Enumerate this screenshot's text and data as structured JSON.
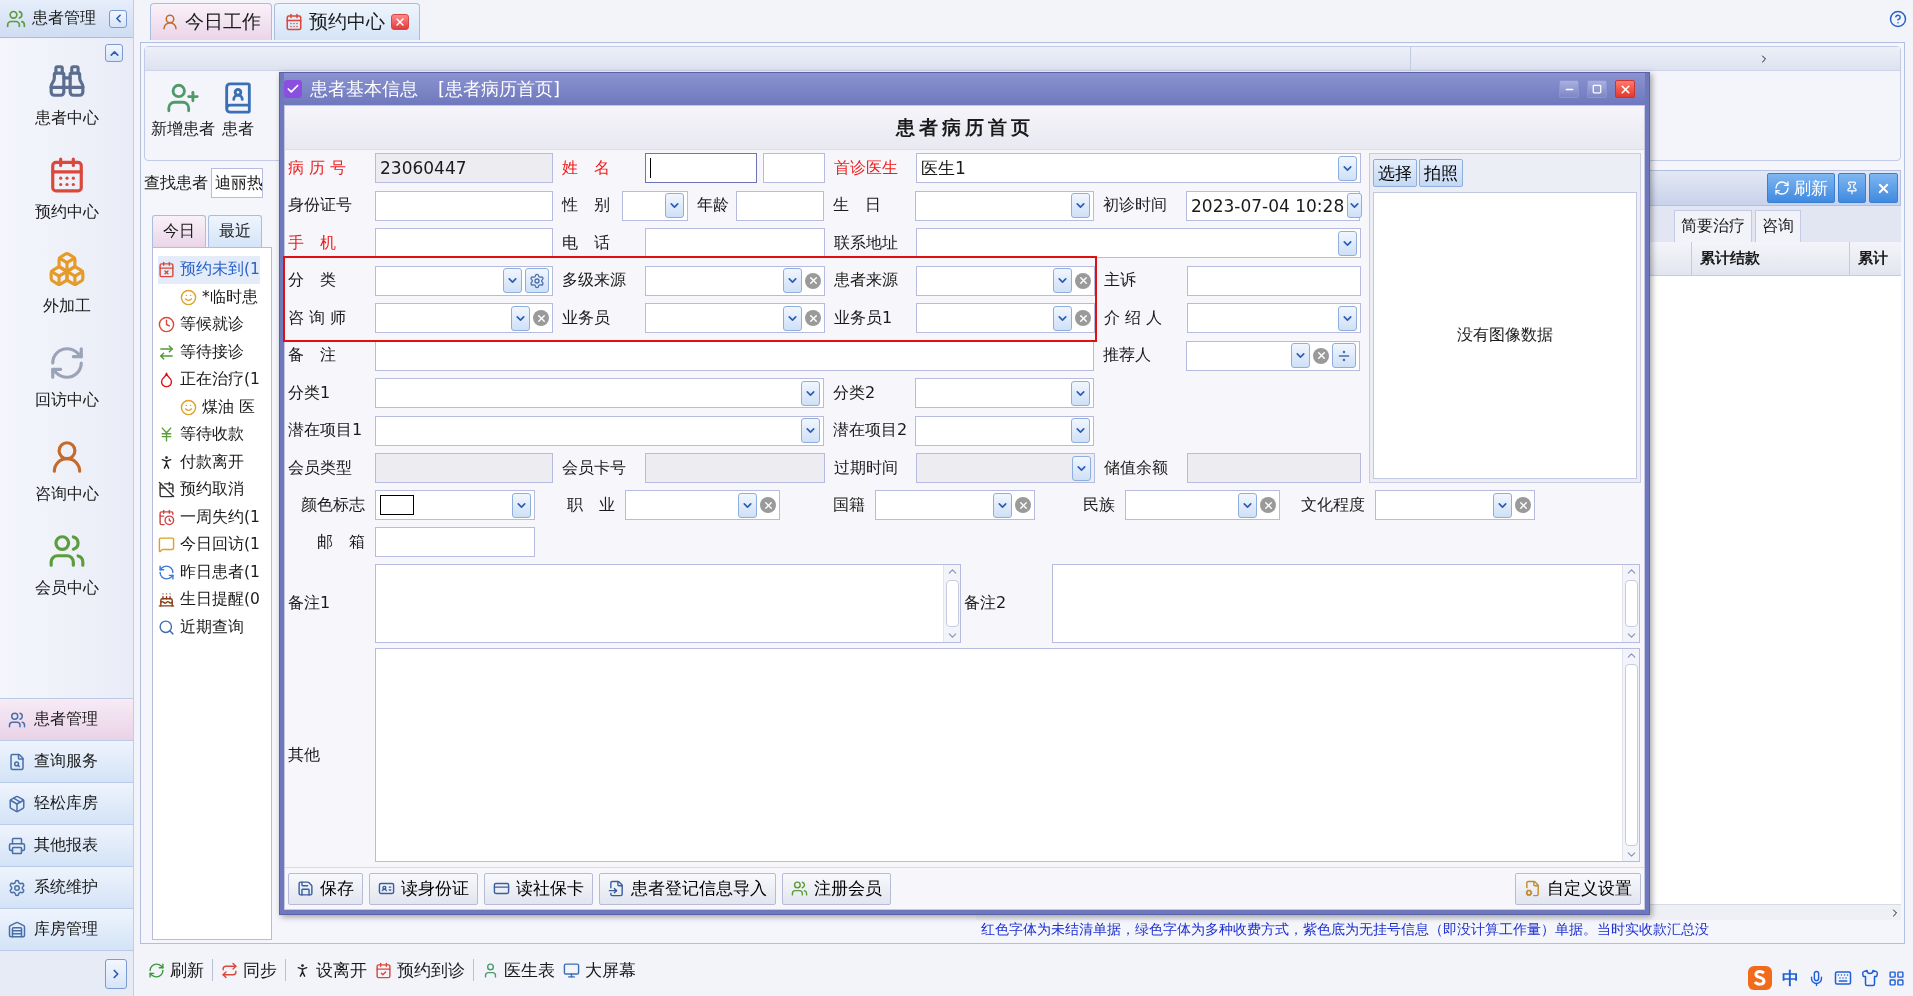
{
  "sidebar": {
    "title": "患者管理",
    "nav": [
      {
        "label": "患者中心"
      },
      {
        "label": "预约中心"
      },
      {
        "label": "外加工"
      },
      {
        "label": "回访中心"
      },
      {
        "label": "咨询中心"
      },
      {
        "label": "会员中心"
      }
    ],
    "sections": [
      {
        "label": "患者管理",
        "selected": true
      },
      {
        "label": "查询服务",
        "selected": false
      },
      {
        "label": "轻松库房",
        "selected": false
      },
      {
        "label": "其他报表",
        "selected": false
      },
      {
        "label": "系统维护",
        "selected": false
      },
      {
        "label": "库房管理",
        "selected": false
      }
    ]
  },
  "tabs": [
    {
      "label": "今日工作",
      "selected": true,
      "closable": false
    },
    {
      "label": "预约中心",
      "selected": false,
      "closable": true
    }
  ],
  "ribbon": {
    "buttons": [
      {
        "label": "新增患者"
      },
      {
        "label": "患者"
      }
    ]
  },
  "search": {
    "label": "查找患者",
    "value": "迪丽热"
  },
  "list_tabs": [
    {
      "label": "今日",
      "selected": true
    },
    {
      "label": "最近",
      "selected": false
    }
  ],
  "tree": [
    {
      "label": "预约未到(1",
      "selected": true,
      "children": [
        {
          "label": "*临时患",
          "selected": false
        }
      ]
    },
    {
      "label": "等候就诊",
      "selected": false
    },
    {
      "label": "等待接诊",
      "selected": false
    },
    {
      "label": "正在治疗(1",
      "selected": false,
      "children": [
        {
          "label": "煤油 医",
          "selected": false
        }
      ]
    },
    {
      "label": "等待收款",
      "selected": false
    },
    {
      "label": "付款离开",
      "selected": false
    },
    {
      "label": "预约取消",
      "selected": false
    },
    {
      "label": "一周失约(1",
      "selected": false
    },
    {
      "label": "今日回访(1",
      "selected": false
    },
    {
      "label": "昨日患者(1",
      "selected": false
    },
    {
      "label": "生日提醒(0",
      "selected": false
    },
    {
      "label": "近期查询",
      "selected": false
    }
  ],
  "detail_panel": {
    "buttons": [
      {
        "label": "刷新"
      }
    ],
    "tabs": [
      {
        "label": "简要治疗"
      },
      {
        "label": "咨询"
      }
    ],
    "columns": [
      "累计结款",
      "累计"
    ],
    "note": "红色字体为未结清单据，绿色字体为多种收费方式，紫色底为无挂号信息（即没计算工作量）单据。当时实收款汇总没"
  },
  "toolbar": [
    {
      "items": [
        {
          "label": "刷新"
        }
      ]
    },
    {
      "items": [
        {
          "label": "同步"
        }
      ]
    },
    {
      "items": [
        {
          "label": "设离开"
        },
        {
          "label": "预约到诊"
        }
      ]
    },
    {
      "items": [
        {
          "label": "医生表"
        },
        {
          "label": "大屏幕"
        }
      ]
    }
  ],
  "tray": {
    "ime": "中"
  },
  "dialog": {
    "title": "患者基本信息",
    "subtitle": "[患者病历首页]",
    "heading": "患者病历首页",
    "grid_rows": [
      [
        {
          "label": "病 历 号",
          "kind": "readonly",
          "value": "23060447",
          "required": true,
          "focused": false
        },
        {
          "label": "姓　名",
          "kind": "text",
          "required": true,
          "focused": true
        },
        {
          "kind": "text",
          "focused": false
        },
        {
          "label": "首诊医生",
          "kind": "combo",
          "value": "医生1",
          "required": true,
          "focused": false
        }
      ],
      [
        {
          "label": "身份证号",
          "kind": "text",
          "required": false,
          "focused": false
        },
        {
          "label": "性　别",
          "kind": "combo",
          "required": false,
          "focused": false
        },
        {
          "label": "年龄",
          "kind": "text",
          "required": false,
          "focused": false
        },
        {
          "label": "生　日",
          "kind": "combo",
          "required": false,
          "focused": false
        },
        {
          "label": "初诊时间",
          "kind": "combo",
          "value": "2023-07-04 10:28",
          "required": false,
          "focused": false
        }
      ],
      [
        {
          "label": "手　机",
          "kind": "text",
          "required": true,
          "focused": false
        },
        {
          "label": "电　话",
          "kind": "text",
          "required": false,
          "focused": false
        },
        {
          "label": "联系地址",
          "kind": "combo",
          "required": false,
          "focused": false
        }
      ],
      [
        {
          "label": "分　类",
          "kind": "combo_gear",
          "required": false,
          "focused": false
        },
        {
          "label": "多级来源",
          "kind": "combo_clear",
          "required": false,
          "focused": false
        },
        {
          "label": "患者来源",
          "kind": "combo_clear",
          "required": false,
          "focused": false
        },
        {
          "label": "主诉",
          "kind": "text",
          "required": false,
          "focused": false
        }
      ],
      [
        {
          "label": "咨 询 师",
          "kind": "combo_clear",
          "required": false,
          "focused": false
        },
        {
          "label": "业务员",
          "kind": "combo_clear",
          "required": false,
          "focused": false
        },
        {
          "label": "业务员1",
          "kind": "combo_clear",
          "required": false,
          "focused": false
        },
        {
          "label": "介 绍 人",
          "kind": "combo",
          "required": false,
          "focused": false
        }
      ],
      [
        {
          "label": "备　注",
          "kind": "text",
          "required": false,
          "focused": false
        },
        {
          "label": "推荐人",
          "kind": "combo_clear_add",
          "required": false,
          "focused": false
        }
      ],
      [
        {
          "label": "分类1",
          "kind": "combo",
          "required": false,
          "focused": false
        },
        {
          "label": "分类2",
          "kind": "combo",
          "required": false,
          "focused": false
        }
      ],
      [
        {
          "label": "潜在项目1",
          "kind": "combo",
          "required": false,
          "focused": false
        },
        {
          "label": "潜在项目2",
          "kind": "combo",
          "required": false,
          "focused": false
        }
      ],
      [
        {
          "label": "会员类型",
          "kind": "readonly",
          "required": false,
          "focused": false
        },
        {
          "label": "会员卡号",
          "kind": "readonly",
          "required": false,
          "focused": false
        },
        {
          "label": "过期时间",
          "kind": "readonly_combo",
          "required": false,
          "focused": false
        },
        {
          "label": "储值余额",
          "kind": "readonly",
          "required": false,
          "focused": false
        }
      ]
    ],
    "image_panel": {
      "buttons": [
        {
          "label": "选择"
        },
        {
          "label": "拍照"
        }
      ],
      "empty_text": "没有图像数据"
    },
    "extra_rows": [
      [
        {
          "label": "颜色标志",
          "kind": "color_combo",
          "required": false,
          "focused": false
        },
        {
          "label": "职　业",
          "kind": "combo_clear",
          "required": false,
          "focused": false
        },
        {
          "label": "国籍",
          "kind": "combo_clear",
          "required": false,
          "focused": false
        },
        {
          "label": "民族",
          "kind": "combo_clear",
          "required": false,
          "focused": false
        },
        {
          "label": "文化程度",
          "kind": "combo_clear",
          "required": false,
          "focused": false
        }
      ],
      [
        {
          "label": "邮　箱",
          "kind": "text",
          "required": false,
          "focused": false
        }
      ]
    ],
    "memo_fields": [
      {
        "label": "备注1"
      },
      {
        "label": "备注2"
      }
    ],
    "other_field": {
      "label": "其他"
    },
    "footer_buttons": [
      {
        "label": "保存"
      },
      {
        "label": "读身份证"
      },
      {
        "label": "读社保卡"
      },
      {
        "label": "患者登记信息导入"
      },
      {
        "label": "注册会员"
      }
    ],
    "settings_button": {
      "label": "自定义设置"
    }
  }
}
